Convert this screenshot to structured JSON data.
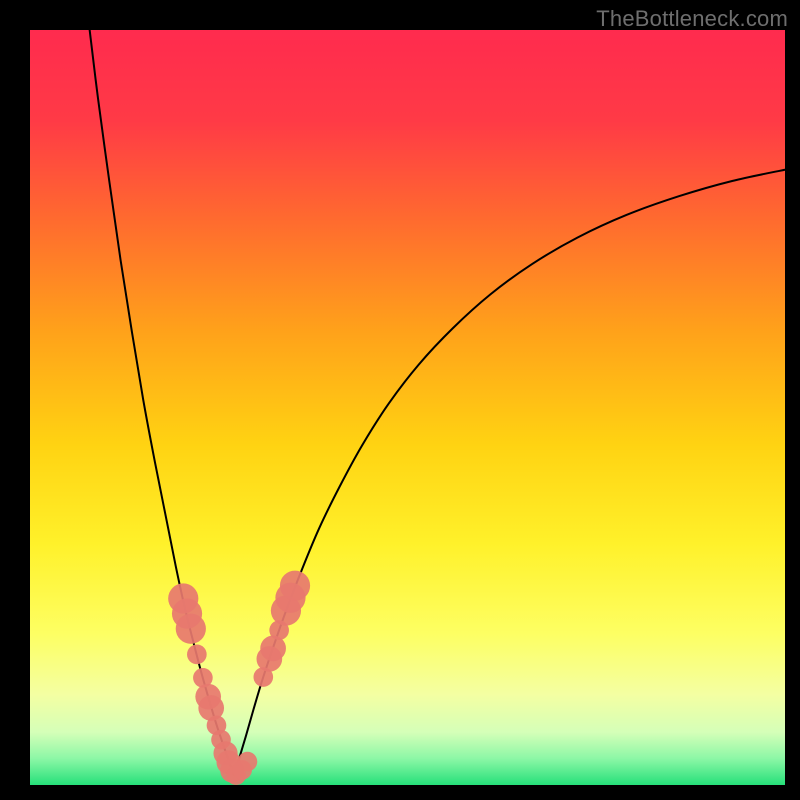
{
  "watermark": "TheBottleneck.com",
  "gradient_stops": [
    {
      "offset": 0.0,
      "color": "#ff2b4e"
    },
    {
      "offset": 0.12,
      "color": "#ff3a46"
    },
    {
      "offset": 0.25,
      "color": "#ff6a2f"
    },
    {
      "offset": 0.4,
      "color": "#ffa21a"
    },
    {
      "offset": 0.55,
      "color": "#ffd312"
    },
    {
      "offset": 0.68,
      "color": "#fff12a"
    },
    {
      "offset": 0.8,
      "color": "#fdff63"
    },
    {
      "offset": 0.88,
      "color": "#f4ffa2"
    },
    {
      "offset": 0.93,
      "color": "#d5ffb8"
    },
    {
      "offset": 0.965,
      "color": "#8cf7a6"
    },
    {
      "offset": 1.0,
      "color": "#26e07a"
    }
  ],
  "chart_data": {
    "type": "line",
    "title": "",
    "xlabel": "",
    "ylabel": "",
    "xlim": [
      0,
      100
    ],
    "ylim": [
      0,
      100
    ],
    "grid": false,
    "series": [
      {
        "name": "left-branch",
        "x": [
          7.9,
          9.0,
          10.5,
          12.0,
          13.5,
          15.0,
          16.5,
          18.0,
          19.3,
          20.5,
          21.7,
          22.8,
          23.8,
          24.7,
          25.6,
          26.4,
          27.0
        ],
        "y": [
          100.0,
          91.0,
          80.0,
          69.5,
          60.0,
          51.0,
          43.0,
          35.5,
          29.0,
          23.5,
          18.7,
          14.5,
          11.0,
          8.0,
          5.3,
          3.0,
          1.3
        ]
      },
      {
        "name": "right-branch",
        "x": [
          27.0,
          27.7,
          28.6,
          29.6,
          30.8,
          32.3,
          34.0,
          36.0,
          38.3,
          41.0,
          44.0,
          47.5,
          51.5,
          56.0,
          61.0,
          66.5,
          72.5,
          79.0,
          86.0,
          93.0,
          100.0
        ],
        "y": [
          1.3,
          3.5,
          6.5,
          10.0,
          14.0,
          18.5,
          23.3,
          28.5,
          34.0,
          39.5,
          45.0,
          50.5,
          55.7,
          60.5,
          65.0,
          69.0,
          72.5,
          75.5,
          78.0,
          80.0,
          81.5
        ]
      }
    ],
    "markers": [
      {
        "name": "left-cluster-upper",
        "x": 20.3,
        "y": 24.7,
        "r": 2.0
      },
      {
        "name": "left-cluster-upper",
        "x": 20.8,
        "y": 22.7,
        "r": 2.0
      },
      {
        "name": "left-cluster-upper",
        "x": 21.3,
        "y": 20.7,
        "r": 2.0
      },
      {
        "name": "left-dot",
        "x": 22.1,
        "y": 17.3,
        "r": 1.3
      },
      {
        "name": "left-dot",
        "x": 22.9,
        "y": 14.2,
        "r": 1.3
      },
      {
        "name": "left-cluster-mid",
        "x": 23.6,
        "y": 11.7,
        "r": 1.7
      },
      {
        "name": "left-cluster-mid",
        "x": 24.0,
        "y": 10.2,
        "r": 1.7
      },
      {
        "name": "left-dot",
        "x": 24.7,
        "y": 7.9,
        "r": 1.3
      },
      {
        "name": "left-dot",
        "x": 25.3,
        "y": 6.0,
        "r": 1.3
      },
      {
        "name": "left-cluster-bottom",
        "x": 25.9,
        "y": 4.2,
        "r": 1.6
      },
      {
        "name": "left-cluster-bottom",
        "x": 26.3,
        "y": 3.0,
        "r": 1.6
      },
      {
        "name": "left-cluster-bottom",
        "x": 26.8,
        "y": 1.9,
        "r": 1.6
      },
      {
        "name": "bottom-dot",
        "x": 27.3,
        "y": 1.3,
        "r": 1.3
      },
      {
        "name": "bottom-dot",
        "x": 28.1,
        "y": 2.0,
        "r": 1.3
      },
      {
        "name": "bottom-dot",
        "x": 28.8,
        "y": 3.1,
        "r": 1.3
      },
      {
        "name": "right-dot",
        "x": 30.9,
        "y": 14.3,
        "r": 1.3
      },
      {
        "name": "right-cluster-mid",
        "x": 31.7,
        "y": 16.7,
        "r": 1.7
      },
      {
        "name": "right-cluster-mid",
        "x": 32.2,
        "y": 18.1,
        "r": 1.7
      },
      {
        "name": "right-dot",
        "x": 33.0,
        "y": 20.5,
        "r": 1.3
      },
      {
        "name": "right-cluster-upper",
        "x": 33.9,
        "y": 23.1,
        "r": 2.0
      },
      {
        "name": "right-cluster-upper",
        "x": 34.5,
        "y": 24.8,
        "r": 2.0
      },
      {
        "name": "right-cluster-upper",
        "x": 35.1,
        "y": 26.4,
        "r": 2.0
      }
    ],
    "marker_color": "#e7786f",
    "curve_color": "#000000"
  }
}
